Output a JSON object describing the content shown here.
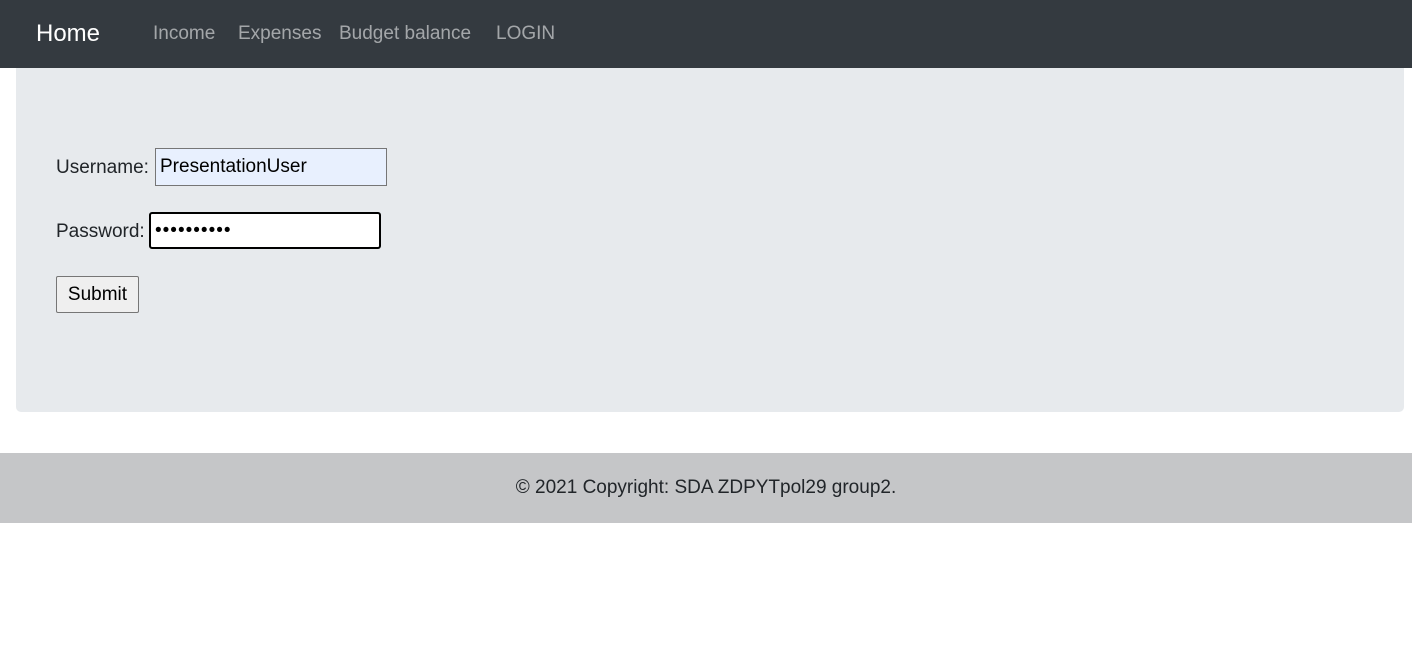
{
  "navbar": {
    "brand": "Home",
    "links": [
      "Income",
      "Expenses",
      "Budget balance",
      "LOGIN"
    ],
    "background_color": "#343a40"
  },
  "login_form": {
    "username_label": "Username:",
    "username_value": "PresentationUser",
    "password_label": "Password:",
    "password_value": "••••••••••",
    "submit_label": "Submit"
  },
  "footer": {
    "text": "© 2021 Copyright: SDA ZDPYTpol29 group2."
  }
}
